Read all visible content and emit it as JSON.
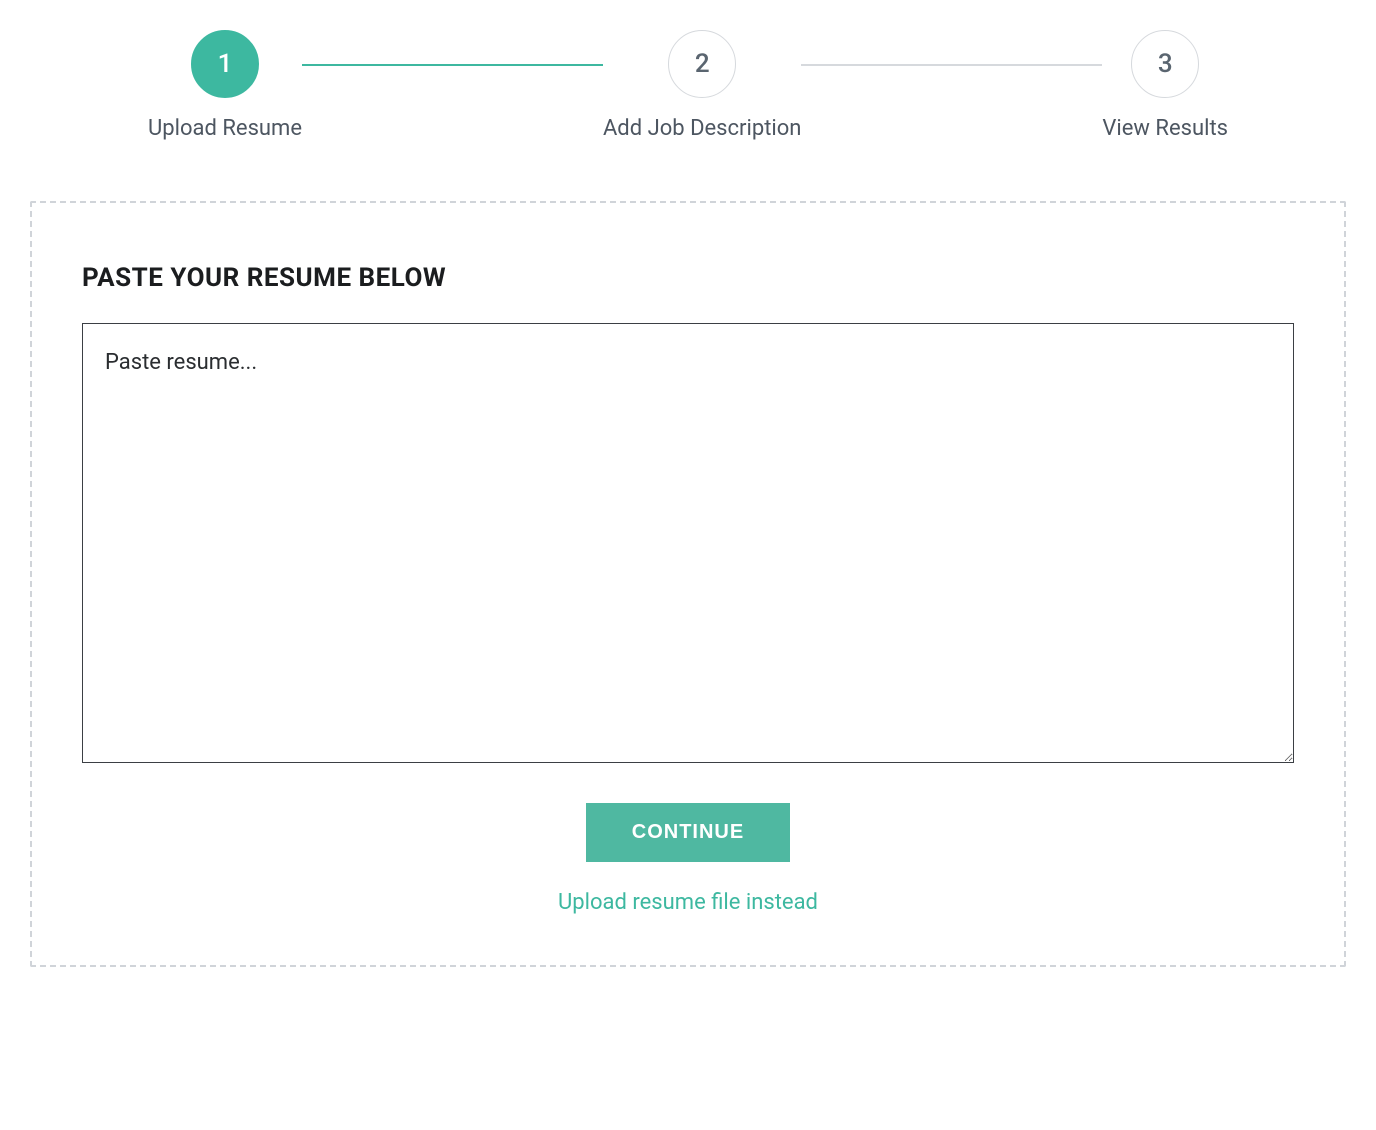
{
  "stepper": {
    "steps": [
      {
        "number": "1",
        "label": "Upload Resume",
        "active": true
      },
      {
        "number": "2",
        "label": "Add Job Description",
        "active": false
      },
      {
        "number": "3",
        "label": "View Results",
        "active": false
      }
    ]
  },
  "panel": {
    "heading": "PASTE YOUR RESUME BELOW",
    "textarea_placeholder": "Paste resume...",
    "textarea_value": "",
    "continue_label": "CONTINUE",
    "upload_link_label": "Upload resume file instead"
  },
  "colors": {
    "accent": "#3db8a0",
    "border_dashed": "#d0d4d9",
    "text_muted": "#4d5661"
  }
}
